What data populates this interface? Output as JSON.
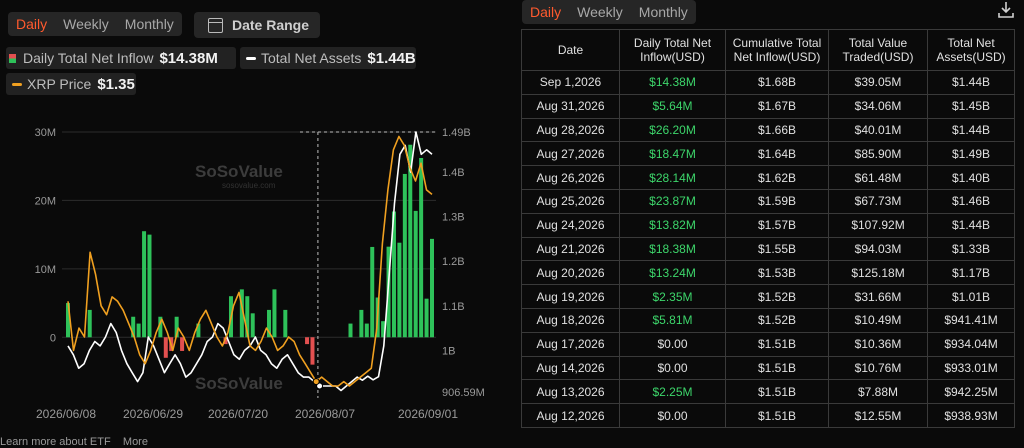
{
  "left_tabs": [
    "Daily",
    "Weekly",
    "Monthly"
  ],
  "date_range_label": "Date Range",
  "legend": {
    "inflow_label": "Daily Total Net Inflow",
    "inflow_value": "$14.38M",
    "assets_label": "Total Net Assets",
    "assets_value": "$1.44B",
    "price_label": "XRP Price",
    "price_value": "$1.35"
  },
  "watermark": {
    "brand": "SoSoValue",
    "site": "sosovalue.com"
  },
  "colors": {
    "accent": "#ff5a2e",
    "inflow_pos": "#2ec25a",
    "inflow_neg": "#e35050",
    "price": "#f0a020",
    "assets": "#ffffff"
  },
  "chart_data": {
    "type": "bar",
    "title": "",
    "x_ticks": [
      "2026/06/08",
      "2026/06/29",
      "2026/07/20",
      "2026/08/07",
      "2026/09/01"
    ],
    "y_left_ticks": [
      "30M",
      "20M",
      "10M",
      "0"
    ],
    "y_right_ticks": [
      "1.49B",
      "1.4B",
      "1.3B",
      "1.2B",
      "1.1B",
      "1B",
      "906.59M"
    ],
    "y_left_range": [
      -8,
      30
    ],
    "y_right_range": [
      0.90659,
      1.49
    ],
    "crosshair_index": 46,
    "series": [
      {
        "name": "Daily Total Net Inflow",
        "type": "bar",
        "values": [
          5,
          0,
          0,
          0,
          4,
          0,
          0,
          0,
          0,
          0,
          0,
          0,
          3,
          2,
          15.5,
          15,
          0,
          3,
          -3,
          -2,
          3,
          -2,
          0,
          0,
          2,
          0,
          0,
          0,
          0,
          -1,
          6,
          0,
          7,
          6,
          3.5,
          0,
          0,
          4,
          7,
          0,
          4,
          0,
          0,
          0,
          -1,
          -4,
          0,
          0,
          0,
          0,
          0,
          0,
          2,
          0,
          4,
          2,
          13.2,
          5.81,
          2.35,
          13.24,
          18.38,
          13.82,
          23.87,
          28.14,
          18.47,
          26.2,
          5.64,
          14.38
        ]
      },
      {
        "name": "Total Net Assets",
        "type": "line",
        "values": [
          1.01,
          0.99,
          0.96,
          0.97,
          1.0,
          1.02,
          1.01,
          1.03,
          1.06,
          1.04,
          1.0,
          0.97,
          0.95,
          0.93,
          0.95,
          1.03,
          1.01,
          0.98,
          0.95,
          0.97,
          0.99,
          0.97,
          0.94,
          0.95,
          0.97,
          0.99,
          1.02,
          1.03,
          1.06,
          1.05,
          1.02,
          0.99,
          0.98,
          1.0,
          1.01,
          1.03,
          1.0,
          0.99,
          0.97,
          0.96,
          0.98,
          0.99,
          0.97,
          0.95,
          0.94,
          0.94,
          0.93,
          0.92,
          0.92,
          0.92,
          0.92,
          0.91,
          0.92,
          0.93,
          0.94,
          0.933,
          0.942,
          0.934,
          0.941,
          1.01,
          1.17,
          1.33,
          1.44,
          1.46,
          1.4,
          1.49,
          1.44,
          1.45,
          1.44
        ]
      },
      {
        "name": "XRP Price",
        "type": "line",
        "values": [
          1.11,
          1.0,
          1.05,
          1.03,
          1.22,
          1.17,
          1.1,
          1.08,
          1.12,
          1.11,
          1.09,
          1.06,
          1.03,
          0.99,
          0.97,
          1.0,
          1.04,
          1.07,
          1.04,
          1.0,
          1.05,
          1.03,
          1.0,
          1.04,
          1.07,
          1.09,
          1.06,
          1.03,
          1.01,
          1.04,
          1.1,
          1.13,
          1.07,
          1.01,
          1.0,
          1.02,
          1.05,
          1.03,
          1.0,
          1.01,
          1.03,
          1.02,
          0.99,
          0.97,
          0.95,
          0.93,
          0.94,
          0.93,
          0.92,
          0.92,
          0.93,
          0.92,
          0.93,
          0.94,
          0.95,
          0.96,
          1.05,
          1.24,
          1.36,
          1.45,
          1.48,
          1.46,
          1.41,
          1.38,
          1.42,
          1.36,
          1.35
        ]
      }
    ]
  },
  "right_tabs": [
    "Daily",
    "Weekly",
    "Monthly"
  ],
  "table": {
    "headers": [
      "Date",
      "Daily Total Net Inflow(USD)",
      "Cumulative Total Net Inflow(USD)",
      "Total Value Traded(USD)",
      "Total Net Assets(USD)"
    ],
    "rows": [
      [
        "Sep 1,2026",
        "$14.38M",
        "$1.68B",
        "$39.05M",
        "$1.44B"
      ],
      [
        "Aug 31,2026",
        "$5.64M",
        "$1.67B",
        "$34.06M",
        "$1.45B"
      ],
      [
        "Aug 28,2026",
        "$26.20M",
        "$1.66B",
        "$40.01M",
        "$1.44B"
      ],
      [
        "Aug 27,2026",
        "$18.47M",
        "$1.64B",
        "$85.90M",
        "$1.49B"
      ],
      [
        "Aug 26,2026",
        "$28.14M",
        "$1.62B",
        "$61.48M",
        "$1.40B"
      ],
      [
        "Aug 25,2026",
        "$23.87M",
        "$1.59B",
        "$67.73M",
        "$1.46B"
      ],
      [
        "Aug 24,2026",
        "$13.82M",
        "$1.57B",
        "$107.92M",
        "$1.44B"
      ],
      [
        "Aug 21,2026",
        "$18.38M",
        "$1.55B",
        "$94.03M",
        "$1.33B"
      ],
      [
        "Aug 20,2026",
        "$13.24M",
        "$1.53B",
        "$125.18M",
        "$1.17B"
      ],
      [
        "Aug 19,2026",
        "$2.35M",
        "$1.52B",
        "$31.66M",
        "$1.01B"
      ],
      [
        "Aug 18,2026",
        "$5.81M",
        "$1.52B",
        "$10.49M",
        "$941.41M"
      ],
      [
        "Aug 17,2026",
        "$0.00",
        "$1.51B",
        "$10.36M",
        "$934.04M"
      ],
      [
        "Aug 14,2026",
        "$0.00",
        "$1.51B",
        "$10.76M",
        "$933.01M"
      ],
      [
        "Aug 13,2026",
        "$2.25M",
        "$1.51B",
        "$7.88M",
        "$942.25M"
      ],
      [
        "Aug 12,2026",
        "$0.00",
        "$1.51B",
        "$12.55M",
        "$938.93M"
      ]
    ]
  },
  "footer": {
    "learn_more": "Learn more about ETF",
    "more": "More"
  }
}
